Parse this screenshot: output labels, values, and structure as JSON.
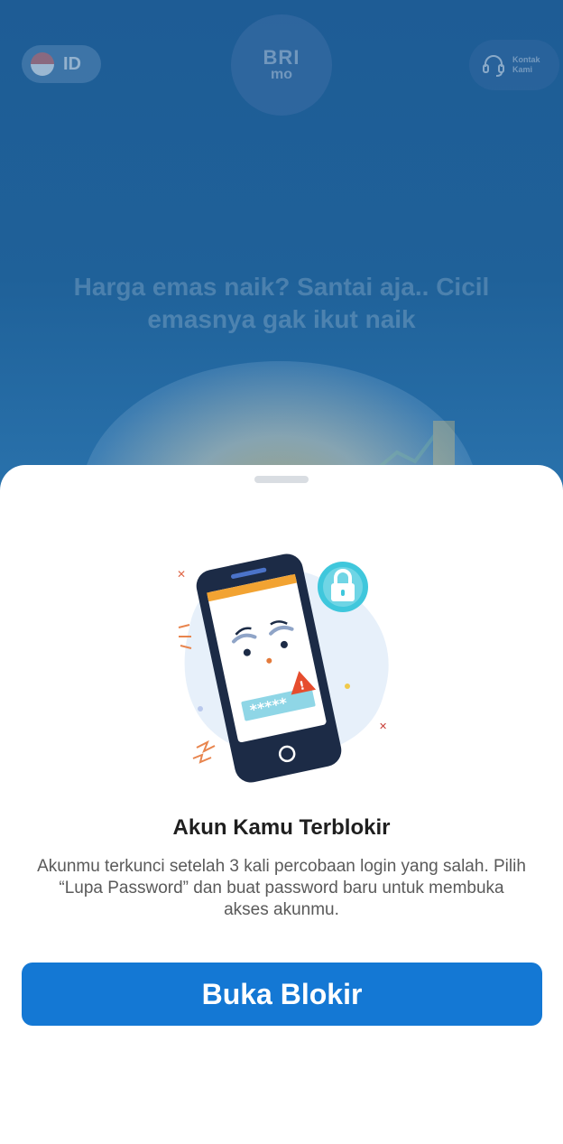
{
  "background": {
    "language": {
      "code": "ID",
      "flag_icon": "indonesia-flag-icon"
    },
    "logo": {
      "line1": "BRI",
      "line2": "mo"
    },
    "contact": {
      "label": "Kontak Kami",
      "icon": "headset-icon"
    },
    "promo": {
      "text": "Harga emas naik? Santai aja.. Cicil emasnya gak ikut naik"
    }
  },
  "sheet": {
    "illustration_icon": "locked-phone-illustration",
    "title": "Akun Kamu Terblokir",
    "body": "Akunmu terkunci setelah 3 kali percobaan login yang salah. Pilih “Lupa Password” dan buat password baru untuk membuka akses akunmu.",
    "button_label": "Buka Blokir",
    "colors": {
      "accent": "#1478d4",
      "overlay": "#1d5a93"
    }
  }
}
